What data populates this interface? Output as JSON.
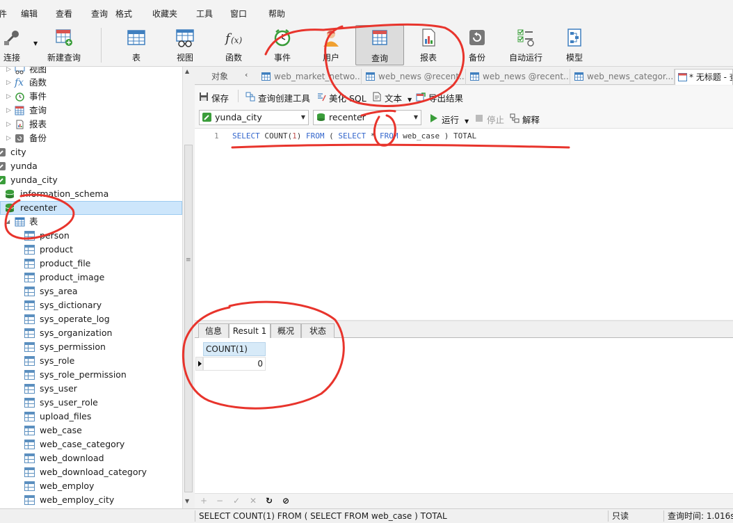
{
  "menu": [
    "件",
    "编辑",
    "查看",
    "查询",
    "格式",
    "收藏夹",
    "工具",
    "窗口",
    "帮助"
  ],
  "toolbar": {
    "connect": "连接",
    "new_query": "新建查询",
    "table": "表",
    "view": "视图",
    "function": "函数",
    "event": "事件",
    "user": "用户",
    "query": "查询",
    "report": "报表",
    "backup": "备份",
    "automation": "自动运行",
    "model": "模型"
  },
  "tree": {
    "top_items": [
      "视图",
      "函数",
      "事件",
      "查询",
      "报表",
      "备份"
    ],
    "connections": [
      "city",
      "yunda",
      "yunda_city"
    ],
    "databases": [
      "information_schema",
      "recenter"
    ],
    "tables_label": "表",
    "tables": [
      "person",
      "product",
      "product_file",
      "product_image",
      "sys_area",
      "sys_dictionary",
      "sys_operate_log",
      "sys_organization",
      "sys_permission",
      "sys_role",
      "sys_role_permission",
      "sys_user",
      "sys_user_role",
      "upload_files",
      "web_case",
      "web_case_category",
      "web_download",
      "web_download_category",
      "web_employ",
      "web_employ_city"
    ]
  },
  "tabs": {
    "objects": "对象",
    "items": [
      "web_market_netwo...",
      "web_news @recent...",
      "web_news @recent...",
      "web_news_categor...",
      "* 无标题 - 查"
    ]
  },
  "query_toolbar": {
    "save": "保存",
    "builder": "查询创建工具",
    "beautify": "美化 SQL",
    "text": "文本",
    "export": "导出结果",
    "connection": "yunda_city",
    "database": "recenter",
    "run": "运行",
    "stop": "停止",
    "explain": "解释"
  },
  "editor": {
    "line_number": "1",
    "sql": "SELECT COUNT(1) FROM ( SELECT * FROM web_case ) TOTAL"
  },
  "result_tabs": [
    "信息",
    "Result 1",
    "概况",
    "状态"
  ],
  "result": {
    "column": "COUNT(1)",
    "value": "0"
  },
  "statusbar": {
    "sql": "SELECT COUNT(1) FROM ( SELECT FROM web_case ) TOTAL",
    "readonly": "只读",
    "query_time": "查询时间: 1.016s"
  },
  "colors": {
    "annotation": "#e8342c",
    "keyword": "#3366cc",
    "selected_row": "#cde6fb"
  }
}
